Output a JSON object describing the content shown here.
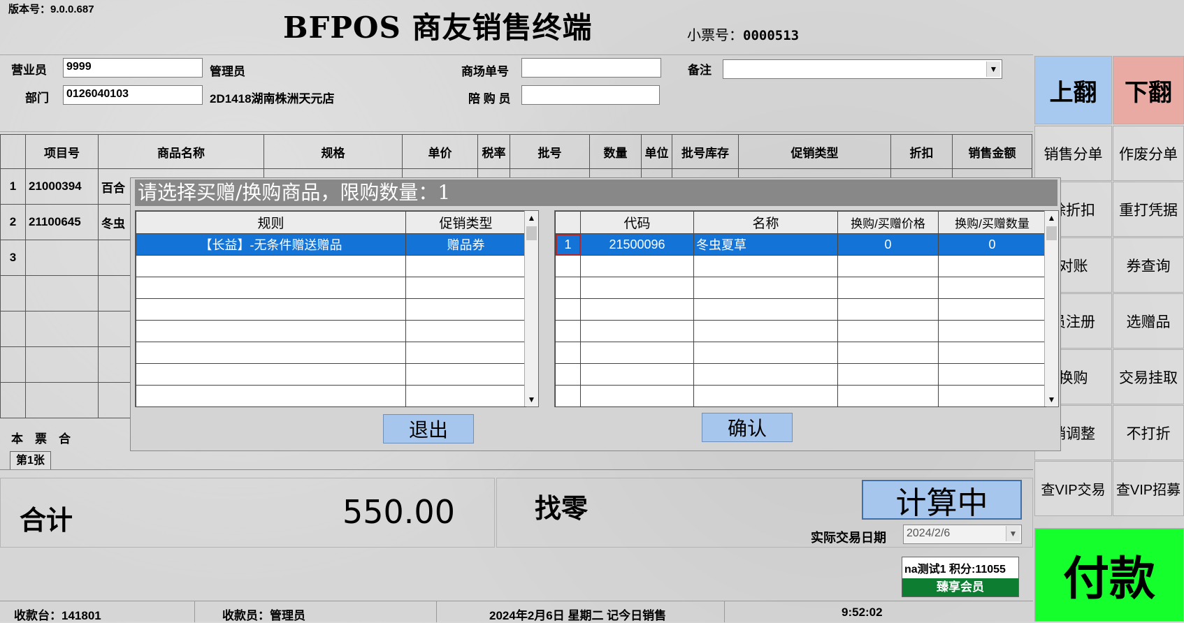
{
  "header": {
    "version": "版本号：9.0.0.687",
    "title": "BFPOS 商友销售终端",
    "ticket_label": "小票号：",
    "ticket_no": "0000513"
  },
  "form": {
    "salesperson_label": "营业员",
    "salesperson_value": "9999",
    "salesperson_name": "管理员",
    "dept_label": "部门",
    "dept_value": "0126040103",
    "dept_name": "2D1418湖南株洲天元店",
    "mall_order_label": "商场单号",
    "mall_order_value": "",
    "companion_label": "陪 购 员",
    "companion_value": "",
    "remark_label": "备注",
    "remark_value": ""
  },
  "right_buttons": {
    "page_up": "上翻",
    "page_down": "下翻",
    "items": [
      "销售分单",
      "作废分单",
      "除折扣",
      "重打凭据",
      "对账",
      "券查询",
      "员注册",
      "选赠品",
      "换购",
      "交易挂取",
      "销调整",
      "不打折",
      "查VIP交易",
      "查VIP招募"
    ],
    "pay": "付款"
  },
  "main_table": {
    "headers": [
      "",
      "项目号",
      "商品名称",
      "规格",
      "单价",
      "税率",
      "批号",
      "数量",
      "单位",
      "批号库存",
      "促销类型",
      "折扣",
      "销售金额"
    ],
    "rows": [
      {
        "no": "1",
        "code": "21000394",
        "name": "百合"
      },
      {
        "no": "2",
        "code": "21100645",
        "name": "冬虫"
      },
      {
        "no": "3",
        "code": "",
        "name": ""
      }
    ],
    "footer": "本　票　合"
  },
  "dialog": {
    "title": "请选择买赠/换购商品，限购数量：1",
    "left_headers": [
      "规则",
      "促销类型"
    ],
    "left_rows": [
      [
        "【长益】-无条件赠送赠品",
        "赠品券"
      ]
    ],
    "right_headers": [
      "",
      "代码",
      "名称",
      "换购/买赠价格",
      "换购/买赠数量"
    ],
    "right_rows": [
      [
        "1",
        "21500096",
        "冬虫夏草",
        "0",
        "0"
      ]
    ],
    "exit": "退出",
    "confirm": "确认"
  },
  "summary": {
    "tab": "第1张",
    "total_label": "合计",
    "total_value": "550.00",
    "change_label": "找零",
    "calc_button": "计算中",
    "date_label": "实际交易日期",
    "date_value": "2024/2/6",
    "member_info": "na测试1 积分:11055",
    "member_level": "臻享会员"
  },
  "status": {
    "register": "收款台：141801",
    "cashier": "收款员：管理员",
    "date": "2024年2月6日 星期二 记今日销售",
    "time": "9:52:02"
  }
}
